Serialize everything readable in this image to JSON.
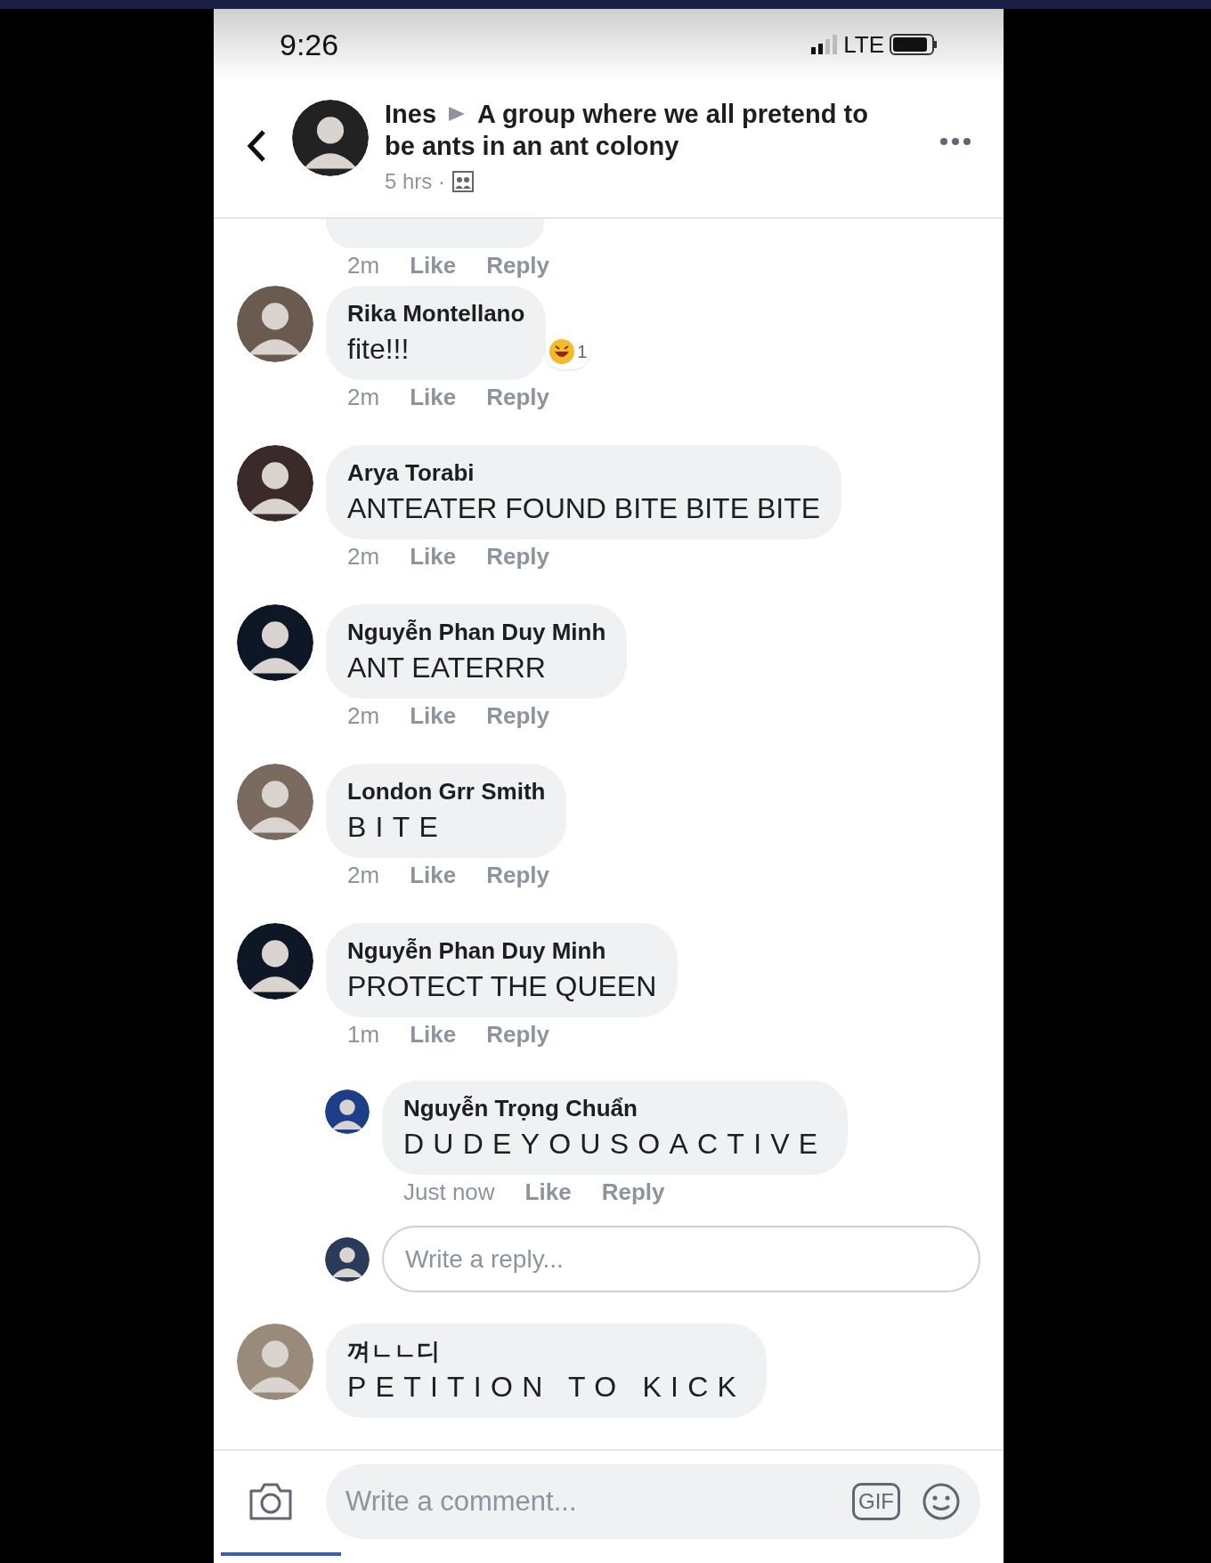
{
  "status_bar": {
    "time": "9:26",
    "network": "LTE"
  },
  "header": {
    "author": "Ines",
    "group": "A group where we all pretend to be ants in an ant colony",
    "time": "5 hrs ·"
  },
  "partial_comment": {
    "time": "2m",
    "like": "Like",
    "reply": "Reply"
  },
  "comments": [
    {
      "name": "Rika Montellano",
      "text": "fite!!!",
      "kind": "plain",
      "time": "2m",
      "like": "Like",
      "reply": "Reply",
      "reaction_count": "1"
    },
    {
      "name": "Arya Torabi",
      "text": "ANTEATER FOUND BITE BITE BITE",
      "kind": "plain",
      "time": "2m",
      "like": "Like",
      "reply": "Reply"
    },
    {
      "name": "Nguyễn Phan Duy Minh",
      "text": "ANT EATERRR",
      "kind": "plain",
      "time": "2m",
      "like": "Like",
      "reply": "Reply"
    },
    {
      "name": "London Grr Smith",
      "text": "BITE",
      "kind": "spaced",
      "time": "2m",
      "like": "Like",
      "reply": "Reply"
    },
    {
      "name": "Nguyễn Phan Duy Minh",
      "text": "PROTECT THE QUEEN",
      "kind": "plain",
      "time": "1m",
      "like": "Like",
      "reply": "Reply",
      "replies": [
        {
          "name": "Nguyễn Trọng Chuẩn",
          "text": "DUDEYOUSOACTIVE",
          "kind": "spaced",
          "time": "Just now",
          "like": "Like",
          "reply": "Reply"
        }
      ],
      "reply_field": {
        "placeholder": "Write a reply..."
      }
    },
    {
      "name": "껴ㄴㄴ디",
      "text": "PETITION TO KICK",
      "kind": "spaced"
    }
  ],
  "composer": {
    "placeholder": "Write a comment...",
    "gif": "GIF"
  }
}
